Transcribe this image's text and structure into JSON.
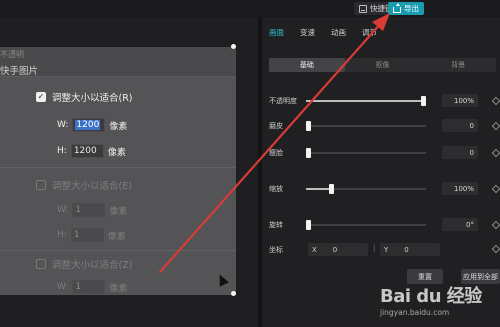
{
  "topbar": {
    "shortcut_label": "快捷键",
    "export_label": "导出",
    "export_color": "#1a9cb0"
  },
  "dialog": {
    "cut_text": "不透明",
    "title": "快手图片",
    "option1": {
      "label": "调整大小以适合(R)",
      "checked": true
    },
    "w_label": "W:",
    "w_value": "1200",
    "h_label": "H:",
    "h_value": "1200",
    "unit": "像素",
    "option2": {
      "label": "调整大小以适合(E)",
      "checked": false
    },
    "option2_w_label": "W:",
    "option2_w_value": "1",
    "option2_h_label": "H:",
    "option2_h_value": "1",
    "option3": {
      "label": "调整大小以适合(Z)",
      "checked": false
    },
    "option3_w_label": "W:",
    "option3_w_value": "1"
  },
  "panel": {
    "tabs": [
      "画面",
      "变速",
      "动画",
      "调节"
    ],
    "active_tab": "画面",
    "accent_color": "#2fc3d7",
    "subtabs": [
      "基础",
      "抠像",
      "背景"
    ],
    "props": {
      "opacity": {
        "label": "不透明度",
        "value": "100%",
        "level": 1.0
      },
      "rotate_blend": {
        "label": "磨皮",
        "value": "0",
        "level": 0.0
      },
      "thin_face": {
        "label": "瘦脸",
        "value": "0",
        "level": 0.0
      },
      "scale": {
        "label": "缩放",
        "value": "100%",
        "level": 0.2
      },
      "rotation": {
        "label": "旋转",
        "value": "0°",
        "level": 0.0
      }
    },
    "coord_label": "坐标",
    "x_label": "X",
    "x_value": "0",
    "y_label": "Y",
    "y_value": "0",
    "reset_label": "重置",
    "apply_all_label": "应用到全部"
  },
  "watermark": {
    "logo": "Bai du 经验",
    "url": "jingyan.baidu.com"
  },
  "annotation_arrow_color": "#d93b36"
}
